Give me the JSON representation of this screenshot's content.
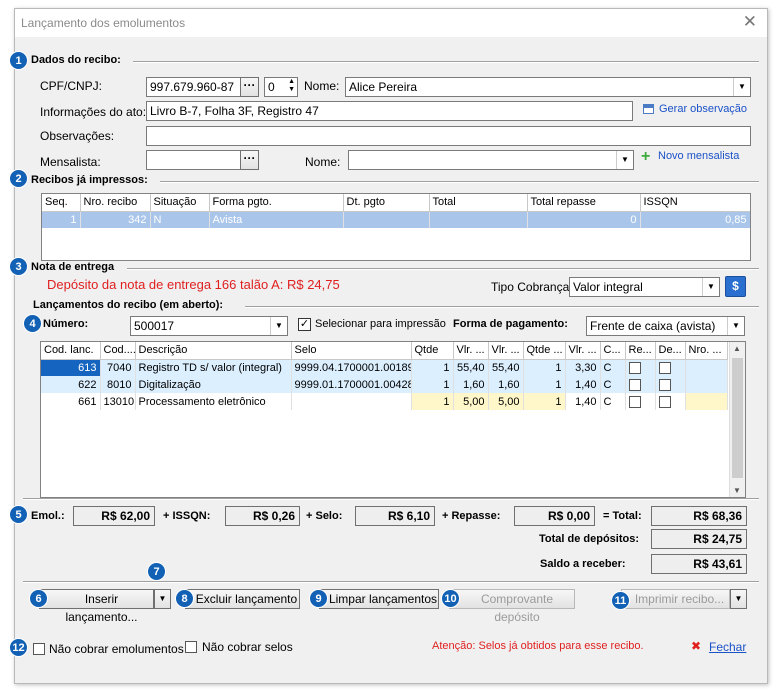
{
  "window": {
    "title": "Lançamento dos emolumentos",
    "close_glyph": "✕"
  },
  "badges": [
    "1",
    "2",
    "3",
    "4",
    "5",
    "6",
    "7",
    "8",
    "9",
    "10",
    "11",
    "12"
  ],
  "sections": {
    "dados": "Dados do recibo:",
    "recibos": "Recibos já impressos:",
    "nota": "Nota de entrega",
    "lancamentos": "Lançamentos do recibo (em aberto):"
  },
  "dados": {
    "cpf_label": "CPF/CNPJ:",
    "cpf_value": "997.679.960-87",
    "ellipsis": "···",
    "spin_value": "0",
    "nome_label": "Nome:",
    "nome_value": "Alice Pereira",
    "info_label": "Informações do ato:",
    "info_value": "Livro B-7, Folha 3F, Registro 47",
    "gerar_obs": "Gerar observação",
    "obs_label": "Observações:",
    "obs_value": "",
    "mensalista_label": "Mensalista:",
    "mensalista_value": "",
    "nome2_label": "Nome:",
    "nome2_value": "",
    "novo_mensalista": "Novo mensalista"
  },
  "recibos": {
    "columns": [
      "Seq.",
      "Nro. recibo",
      "Situação",
      "Forma pgto.",
      "Dt. pgto",
      "Total",
      "Total repasse",
      "ISSQN"
    ],
    "rows": [
      [
        "1",
        "342",
        "N",
        "Avista",
        "",
        "",
        "0",
        "0,85"
      ]
    ]
  },
  "nota": {
    "message": "Depósito da nota de entrega 166 talão A: R$ 24,75",
    "tipo_label": "Tipo Cobrança:",
    "tipo_value": "Valor integral",
    "dollar": "$"
  },
  "lanc": {
    "numero_label": "Número:",
    "numero_value": "500017",
    "selecionar_label": "Selecionar para impressão",
    "check": "✓",
    "forma_label": "Forma de pagamento:",
    "forma_value": "Frente de caixa (avista)",
    "columns": [
      "Cod. lanc.",
      "Cod....",
      "Descrição",
      "Selo",
      "Qtde",
      "Vlr. ...",
      "Vlr. ...",
      "Qtde ...",
      "Vlr. ...",
      "C...",
      "Re...",
      "De...",
      "Nro. ..."
    ],
    "rows": [
      [
        "613",
        "7040",
        "Registro TD s/ valor (integral)",
        "9999.04.1700001.00189",
        "1",
        "55,40",
        "55,40",
        "1",
        "3,30",
        "C",
        "",
        "",
        ""
      ],
      [
        "622",
        "8010",
        "Digitalização",
        "9999.01.1700001.00428",
        "1",
        "1,60",
        "1,60",
        "1",
        "1,40",
        "C",
        "",
        "",
        ""
      ],
      [
        "661",
        "13010",
        "Processamento eletrônico",
        "",
        "1",
        "5,00",
        "5,00",
        "1",
        "1,40",
        "C",
        "",
        "",
        ""
      ]
    ]
  },
  "totals": {
    "emol_label": "Emol.:",
    "emol_value": "R$ 62,00",
    "issqn_label": "+ ISSQN:",
    "issqn_value": "R$ 0,26",
    "selo_label": "+ Selo:",
    "selo_value": "R$ 6,10",
    "repasse_label": "+ Repasse:",
    "repasse_value": "R$ 0,00",
    "total_label": "= Total:",
    "total_value": "R$ 68,36",
    "depositos_label": "Total de depósitos:",
    "depositos_value": "R$ 24,75",
    "saldo_label": "Saldo a receber:",
    "saldo_value": "R$ 43,61"
  },
  "buttons": {
    "inserir": "Inserir lançamento...",
    "excluir": "Excluir lançamento",
    "limpar": "Limpar lançamentos",
    "comprovante": "Comprovante depósito",
    "imprimir": "Imprimir recibo...",
    "arrow": "▼"
  },
  "footer": {
    "nao_emol": "Não cobrar emolumentos",
    "nao_selos": "Não cobrar selos",
    "atencao": "Atenção: Selos já obtidos para esse recibo.",
    "fechar": "Fechar",
    "fechar_glyph": "✖"
  },
  "colors": {
    "accent": "#1261b5",
    "warning": "#e01f1f",
    "link": "#1a52c8",
    "selection": "#a9c6ea"
  }
}
